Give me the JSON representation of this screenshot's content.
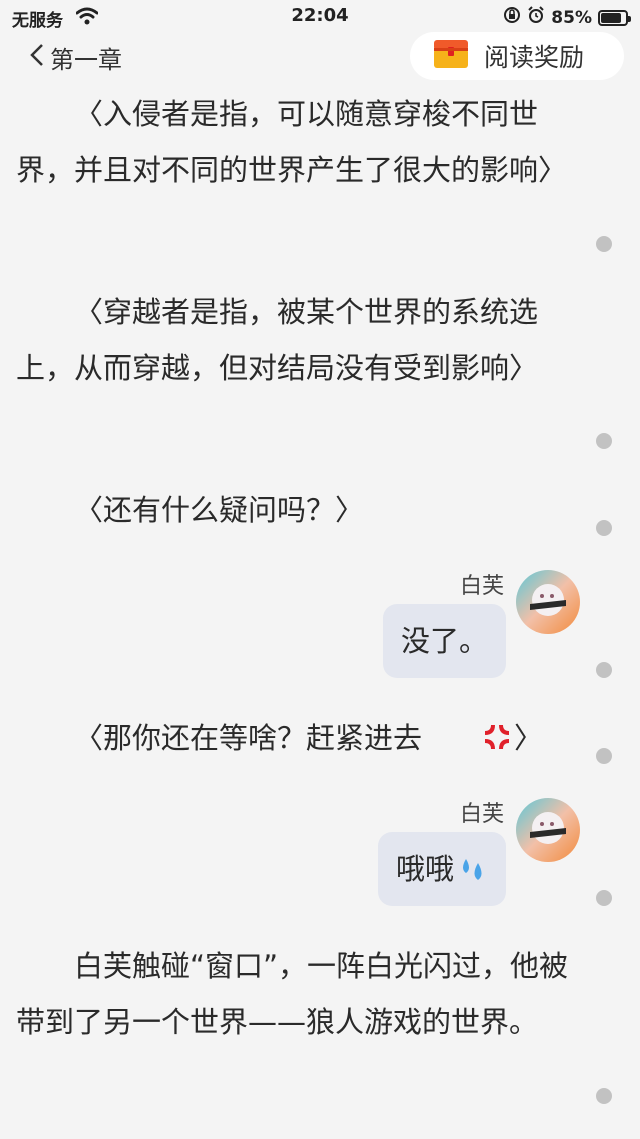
{
  "status": {
    "carrier": "无服务",
    "time": "22:04",
    "battery": "85%",
    "battery_level": 0.85
  },
  "nav": {
    "back_label": "第一章",
    "reward_label": "阅读奖励"
  },
  "content": {
    "p1": "〈入侵者是指，可以随意穿梭不同世界，并且对不同的世界产生了很大的影响〉",
    "p2": "〈穿越者是指，被某个世界的系统选上，从而穿越，但对结局没有受到影响〉",
    "p3": "〈还有什么疑问吗？〉",
    "chat1": {
      "name": "白芙",
      "text": "没了。"
    },
    "p4_text": "〈那你还在等啥？赶紧进去",
    "p4_end": "〉",
    "chat2": {
      "name": "白芙",
      "text": "哦哦"
    },
    "p5": "白芙触碰“窗口”，一阵白光闪过，他被带到了另一个世界——狼人游戏的世界。"
  },
  "icons": {
    "p4_emoji": "anger-symbol-icon",
    "chat2_emoji": "sweat-droplets-icon",
    "accent_red": "#e0202a",
    "bubble_bg": "#e3e6ef"
  }
}
